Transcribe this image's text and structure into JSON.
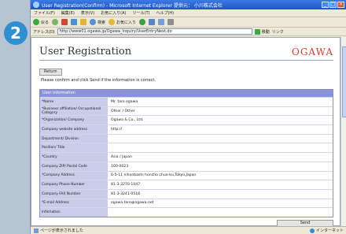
{
  "step_number": "2",
  "window": {
    "title": "User Registration(Confirm) - Microsoft Internet Explorer 提供元： 小川株式会社"
  },
  "menubar": [
    "ファイル(F)",
    "編集(E)",
    "表示(V)",
    "お気に入り(A)",
    "ツール(T)",
    "ヘルプ(H)"
  ],
  "toolbar": {
    "back_label": "戻る",
    "search_label": "検索",
    "favorites_label": "お気に入り"
  },
  "addressbar": {
    "label": "アドレス(D)",
    "url": "http://www01.ogawa.jp/Ogawa_Inquiry/UserEntryNext.do",
    "go_label": "移動",
    "links_label": "リンク"
  },
  "page": {
    "title": "User Registration",
    "logo": "OGAWA",
    "return_label": "Return",
    "instructions": "Please confirm and click Send if the information is correct.",
    "table_header": "User Information",
    "rows": [
      {
        "label": "*Name",
        "value": "Mr. taro ogawa"
      },
      {
        "label": "*Business affiliation/ Occupational Category",
        "value": "Other / Other"
      },
      {
        "label": "*Organization/ Company",
        "value": "Ogawa & Co., Ltd."
      },
      {
        "label": "Company website address",
        "value": "http://"
      },
      {
        "label": "Department/ Division",
        "value": ""
      },
      {
        "label": "Position/ Title",
        "value": ""
      },
      {
        "label": "*Country",
        "value": "Asia / Japan"
      },
      {
        "label": "Company ZIP/ Postal Code",
        "value": "100-0023"
      },
      {
        "label": "*Company Address",
        "value": "6-5-11 nihonbashi honcho chuo-ku,Tokyo,Japan"
      },
      {
        "label": "Company Phone Number",
        "value": "81-3-3270-1047"
      },
      {
        "label": "Company FAX Number",
        "value": "81-3-3241-0516"
      },
      {
        "label": "*E-mail Address",
        "value": "ogawa.taro@ogawa.net"
      },
      {
        "label": "Infomation",
        "value": ""
      }
    ],
    "send_label": "Send"
  },
  "statusbar": {
    "left": "ページが表示されました",
    "zone": "インターネット"
  }
}
